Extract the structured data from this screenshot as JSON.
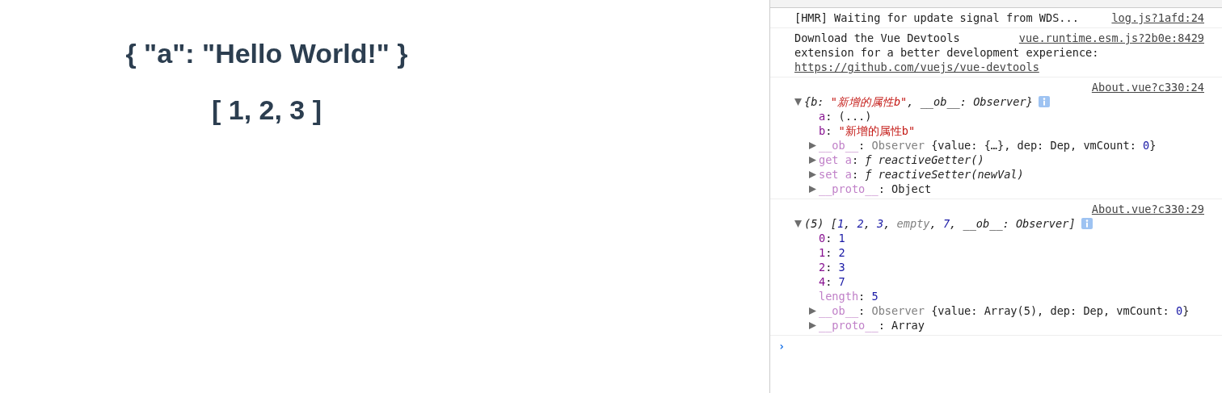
{
  "page": {
    "headings": [
      "{ \"a\": \"Hello World!\" }",
      "[ 1, 2, 3 ]"
    ]
  },
  "console": {
    "messages": [
      {
        "kind": "text",
        "source": "log.js?1afd:24",
        "lines": [
          "[HMR] Waiting for update signal from WDS..."
        ]
      },
      {
        "kind": "text",
        "source": "vue.runtime.esm.js?2b0e:8429",
        "lines": [
          "Download the Vue Devtools",
          "extension for a better development experience:"
        ],
        "link": "https://github.com/vuejs/vue-devtools"
      },
      {
        "kind": "tree",
        "source": "About.vue?c330:24",
        "root": {
          "expanded": true,
          "info": true,
          "tokens": [
            {
              "kind": "plain",
              "text": "{b: "
            },
            {
              "kind": "string",
              "text": "\"新增的属性b\""
            },
            {
              "kind": "plain",
              "text": ", __ob__: Observer}"
            }
          ],
          "children": [
            {
              "tokens": [
                {
                  "kind": "key",
                  "text": "a"
                },
                {
                  "kind": "plain",
                  "text": ": (...)"
                }
              ]
            },
            {
              "tokens": [
                {
                  "kind": "key",
                  "text": "b"
                },
                {
                  "kind": "plain",
                  "text": ": "
                },
                {
                  "kind": "string",
                  "text": "\"新增的属性b\""
                }
              ]
            },
            {
              "expanded": false,
              "tokens": [
                {
                  "kind": "dimkey",
                  "text": "__ob__"
                },
                {
                  "kind": "plain",
                  "text": ": "
                },
                {
                  "kind": "dim",
                  "text": "Observer"
                },
                {
                  "kind": "plain",
                  "text": " {value: {…}, dep: Dep, vmCount: "
                },
                {
                  "kind": "number",
                  "text": "0"
                },
                {
                  "kind": "plain",
                  "text": "}"
                }
              ]
            },
            {
              "expanded": false,
              "tokens": [
                {
                  "kind": "dimkey",
                  "text": "get a"
                },
                {
                  "kind": "plain",
                  "text": ": "
                },
                {
                  "kind": "func",
                  "text": "ƒ reactiveGetter()"
                }
              ]
            },
            {
              "expanded": false,
              "tokens": [
                {
                  "kind": "dimkey",
                  "text": "set a"
                },
                {
                  "kind": "plain",
                  "text": ": "
                },
                {
                  "kind": "func",
                  "text": "ƒ reactiveSetter(newVal)"
                }
              ]
            },
            {
              "expanded": false,
              "tokens": [
                {
                  "kind": "dimkey",
                  "text": "__proto__"
                },
                {
                  "kind": "plain",
                  "text": ": Object"
                }
              ]
            }
          ]
        }
      },
      {
        "kind": "tree",
        "source": "About.vue?c330:29",
        "root": {
          "expanded": true,
          "info": true,
          "tokens": [
            {
              "kind": "plain",
              "text": "(5) ["
            },
            {
              "kind": "number",
              "text": "1"
            },
            {
              "kind": "plain",
              "text": ", "
            },
            {
              "kind": "number",
              "text": "2"
            },
            {
              "kind": "plain",
              "text": ", "
            },
            {
              "kind": "number",
              "text": "3"
            },
            {
              "kind": "plain",
              "text": ", "
            },
            {
              "kind": "dim",
              "text": "empty"
            },
            {
              "kind": "plain",
              "text": ", "
            },
            {
              "kind": "number",
              "text": "7"
            },
            {
              "kind": "plain",
              "text": ", __ob__: Observer]"
            }
          ],
          "children": [
            {
              "tokens": [
                {
                  "kind": "key",
                  "text": "0"
                },
                {
                  "kind": "plain",
                  "text": ": "
                },
                {
                  "kind": "number",
                  "text": "1"
                }
              ]
            },
            {
              "tokens": [
                {
                  "kind": "key",
                  "text": "1"
                },
                {
                  "kind": "plain",
                  "text": ": "
                },
                {
                  "kind": "number",
                  "text": "2"
                }
              ]
            },
            {
              "tokens": [
                {
                  "kind": "key",
                  "text": "2"
                },
                {
                  "kind": "plain",
                  "text": ": "
                },
                {
                  "kind": "number",
                  "text": "3"
                }
              ]
            },
            {
              "tokens": [
                {
                  "kind": "key",
                  "text": "4"
                },
                {
                  "kind": "plain",
                  "text": ": "
                },
                {
                  "kind": "number",
                  "text": "7"
                }
              ]
            },
            {
              "tokens": [
                {
                  "kind": "dimkey",
                  "text": "length"
                },
                {
                  "kind": "plain",
                  "text": ": "
                },
                {
                  "kind": "number",
                  "text": "5"
                }
              ]
            },
            {
              "expanded": false,
              "tokens": [
                {
                  "kind": "dimkey",
                  "text": "__ob__"
                },
                {
                  "kind": "plain",
                  "text": ": "
                },
                {
                  "kind": "dim",
                  "text": "Observer"
                },
                {
                  "kind": "plain",
                  "text": " {value: Array(5), dep: Dep, vmCount: "
                },
                {
                  "kind": "number",
                  "text": "0"
                },
                {
                  "kind": "plain",
                  "text": "}"
                }
              ]
            },
            {
              "expanded": false,
              "tokens": [
                {
                  "kind": "dimkey",
                  "text": "__proto__"
                },
                {
                  "kind": "plain",
                  "text": ": Array"
                }
              ]
            }
          ]
        }
      }
    ],
    "prompt": "›"
  }
}
